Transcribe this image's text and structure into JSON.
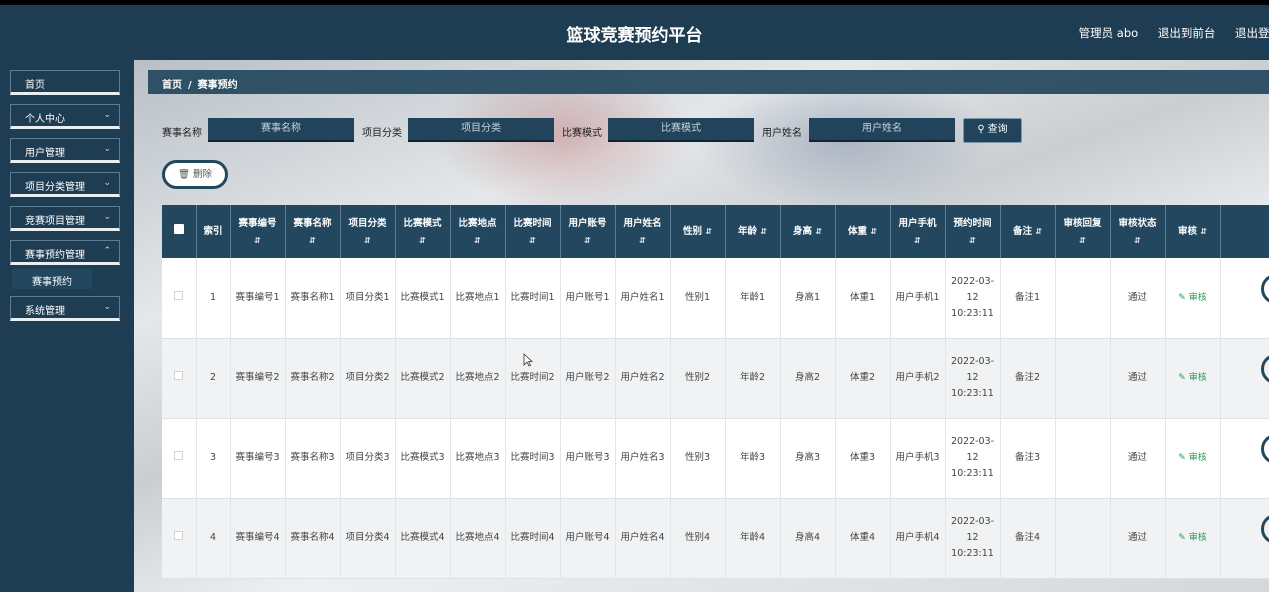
{
  "header": {
    "title": "篮球竞赛预约平台",
    "admin": "管理员 abo",
    "back_front": "退出到前台",
    "logout": "退出登录"
  },
  "sidebar": {
    "items": [
      {
        "label": "首页"
      },
      {
        "label": "个人中心"
      },
      {
        "label": "用户管理"
      },
      {
        "label": "项目分类管理"
      },
      {
        "label": "竞赛项目管理"
      },
      {
        "label": "赛事预约管理"
      },
      {
        "label": "系统管理"
      }
    ],
    "sub_item": "赛事预约"
  },
  "breadcrumb": {
    "home": "首页",
    "sep": "/",
    "current": "赛事预约"
  },
  "search": {
    "f1_label": "赛事名称",
    "f1_placeholder": "赛事名称",
    "f2_label": "项目分类",
    "f2_placeholder": "项目分类",
    "f3_label": "比赛模式",
    "f3_placeholder": "比赛模式",
    "f4_label": "用户姓名",
    "f4_placeholder": "用户姓名",
    "button": "查询"
  },
  "delete_button": "删除",
  "icons": {
    "search": "search-icon",
    "delete": "trash-icon",
    "edit": "edit-icon",
    "sort": "sort-icon"
  },
  "colors": {
    "primary": "#23475f",
    "audit": "#2e9a55"
  },
  "table": {
    "headers": [
      "索引",
      "赛事编号",
      "赛事名称",
      "项目分类",
      "比赛模式",
      "比赛地点",
      "比赛时间",
      "用户账号",
      "用户姓名",
      "性别",
      "年龄",
      "身高",
      "体重",
      "用户手机",
      "预约时间",
      "备注",
      "审核回复",
      "审核状态",
      "审核"
    ],
    "rows": [
      [
        "1",
        "赛事编号1",
        "赛事名称1",
        "项目分类1",
        "比赛模式1",
        "比赛地点1",
        "比赛时间1",
        "用户账号1",
        "用户姓名1",
        "性别1",
        "年龄1",
        "身高1",
        "体重1",
        "用户手机1",
        "2022-03-12 10:23:11",
        "备注1",
        "",
        "通过",
        "审核"
      ],
      [
        "2",
        "赛事编号2",
        "赛事名称2",
        "项目分类2",
        "比赛模式2",
        "比赛地点2",
        "比赛时间2",
        "用户账号2",
        "用户姓名2",
        "性别2",
        "年龄2",
        "身高2",
        "体重2",
        "用户手机2",
        "2022-03-12 10:23:11",
        "备注2",
        "",
        "通过",
        "审核"
      ],
      [
        "3",
        "赛事编号3",
        "赛事名称3",
        "项目分类3",
        "比赛模式3",
        "比赛地点3",
        "比赛时间3",
        "用户账号3",
        "用户姓名3",
        "性别3",
        "年龄3",
        "身高3",
        "体重3",
        "用户手机3",
        "2022-03-12 10:23:11",
        "备注3",
        "",
        "通过",
        "审核"
      ],
      [
        "4",
        "赛事编号4",
        "赛事名称4",
        "项目分类4",
        "比赛模式4",
        "比赛地点4",
        "比赛时间4",
        "用户账号4",
        "用户姓名4",
        "性别4",
        "年龄4",
        "身高4",
        "体重4",
        "用户手机4",
        "2022-03-12 10:23:11",
        "备注4",
        "",
        "通过",
        "审核"
      ]
    ]
  }
}
